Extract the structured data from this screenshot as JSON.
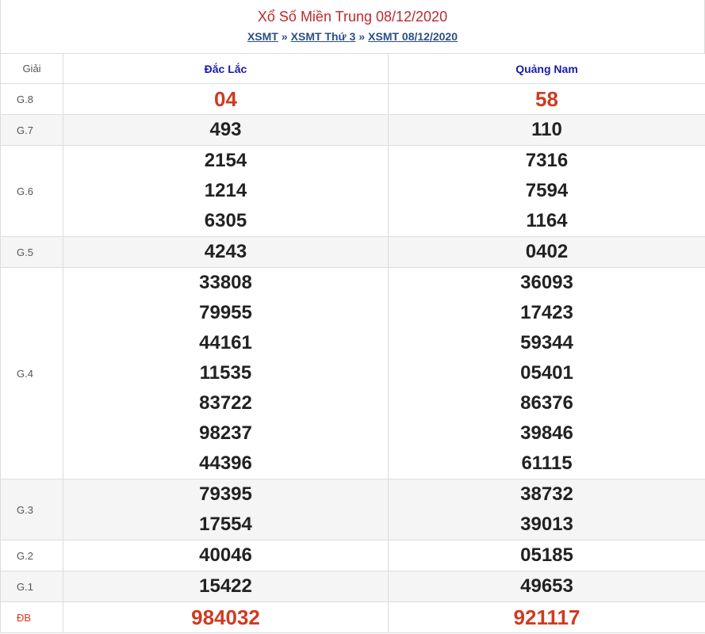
{
  "title": "Xổ Số Miền Trung 08/12/2020",
  "breadcrumb": [
    "XSMT",
    "XSMT Thứ 3",
    "XSMT 08/12/2020"
  ],
  "breadcrumb_sep": "»",
  "table": {
    "prize_header": "Giải",
    "provinces": [
      "Đắc Lắc",
      "Quảng Nam"
    ],
    "rows": [
      {
        "label": "G.8",
        "cols": [
          [
            "04"
          ],
          [
            "58"
          ]
        ]
      },
      {
        "label": "G.7",
        "cols": [
          [
            "493"
          ],
          [
            "110"
          ]
        ]
      },
      {
        "label": "G.6",
        "cols": [
          [
            "2154",
            "1214",
            "6305"
          ],
          [
            "7316",
            "7594",
            "1164"
          ]
        ]
      },
      {
        "label": "G.5",
        "cols": [
          [
            "4243"
          ],
          [
            "0402"
          ]
        ]
      },
      {
        "label": "G.4",
        "cols": [
          [
            "33808",
            "79955",
            "44161",
            "11535",
            "83722",
            "98237",
            "44396"
          ],
          [
            "36093",
            "17423",
            "59344",
            "05401",
            "86376",
            "39846",
            "61115"
          ]
        ]
      },
      {
        "label": "G.3",
        "cols": [
          [
            "79395",
            "17554"
          ],
          [
            "38732",
            "39013"
          ]
        ]
      },
      {
        "label": "G.2",
        "cols": [
          [
            "40046"
          ],
          [
            "05185"
          ]
        ]
      },
      {
        "label": "G.1",
        "cols": [
          [
            "15422"
          ],
          [
            "49653"
          ]
        ]
      },
      {
        "label": "ĐB",
        "cols": [
          [
            "984032"
          ],
          [
            "921117"
          ]
        ]
      }
    ]
  },
  "colors": {
    "title": "#c0282d",
    "link": "#2c4f82",
    "province": "#1a1aa8",
    "highlight": "#d03a20"
  }
}
